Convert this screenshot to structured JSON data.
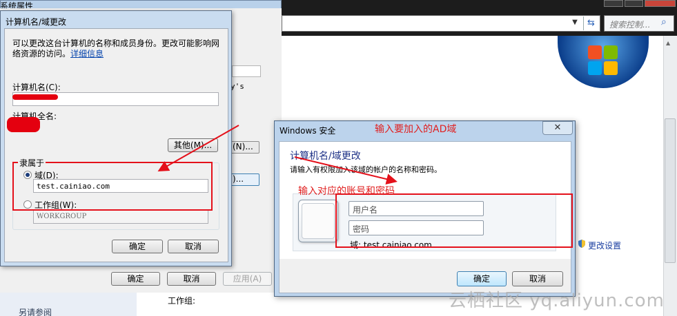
{
  "explorer": {
    "search_placeholder": "搜索控制...",
    "see_also": "另请参阅",
    "workgroup_label": "工作组:",
    "change_settings": "更改设置",
    "watermark": "云栖社区 yq.aliyun.com"
  },
  "system_properties": {
    "title": "系统属性",
    "ghost_text": "y's",
    "ghost_button_1": "(N)...",
    "ghost_button_2": ")...",
    "buttons": {
      "ok": "确定",
      "cancel": "取消",
      "apply": "应用(A)"
    }
  },
  "computer_name_dialog": {
    "title": "计算机名/域更改",
    "description": "可以更改这台计算机的名称和成员身份。更改可能影响网络资源的访问。",
    "more_info_link": "详细信息",
    "computer_name_label": "计算机名(C):",
    "full_name_label": "计算机全名:",
    "other_button": "其他(M)...",
    "member_of_label": "隶属于",
    "domain_radio_label": "域(D):",
    "domain_value": "test.cainiao.com",
    "workgroup_radio_label": "工作组(W):",
    "workgroup_value": "WORKGROUP",
    "ok": "确定",
    "cancel": "取消"
  },
  "security_dialog": {
    "title": "Windows 安全",
    "heading": "计算机名/域更改",
    "subtitle": "请输入有权限加入该域的帐户的名称和密码。",
    "username_placeholder": "用户名",
    "password_placeholder": "密码",
    "domain_text": "域: test.cainiao.com",
    "ok": "确定",
    "cancel": "取消",
    "close": "✕"
  },
  "annotations": {
    "ad_domain": "输入要加入的AD域",
    "credentials": "输入对应的账号和密码"
  },
  "colors": {
    "annotation_red": "#e4101a",
    "title_blue": "#1e3287"
  }
}
